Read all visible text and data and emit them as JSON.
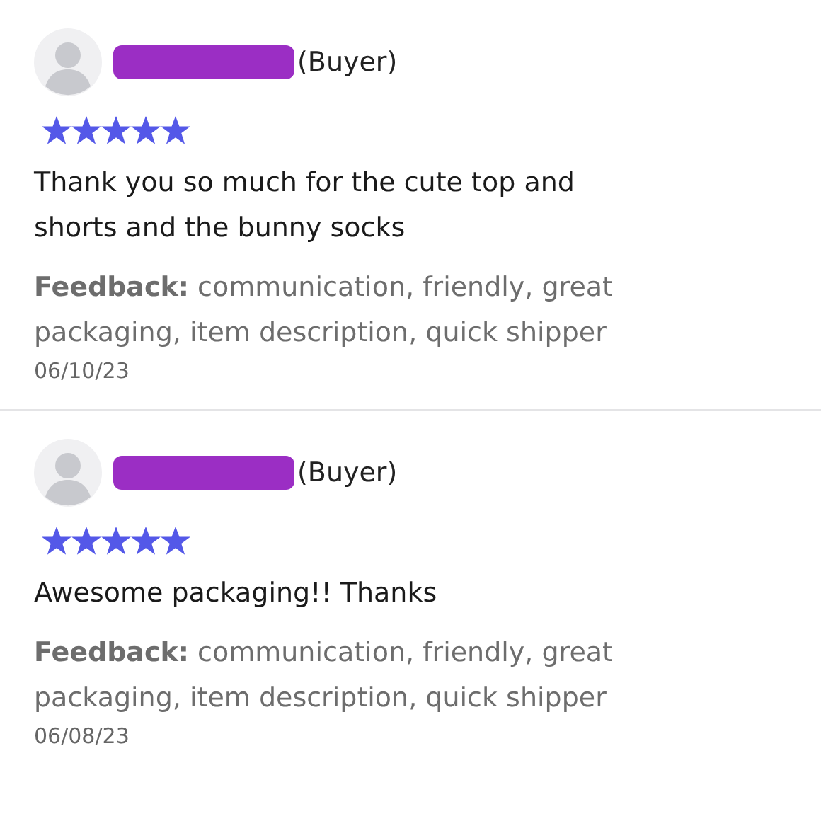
{
  "reviews": [
    {
      "role": "(Buyer)",
      "stars": 5,
      "comment": "Thank you so much for the cute top and shorts and the bunny socks",
      "feedback": "**Feedback:** communication, friendly, great packaging, item description, quick shipper",
      "date": "06/10/23"
    },
    {
      "role": "(Buyer)",
      "stars": 5,
      "comment": "Awesome packaging!! Thanks",
      "feedback": "**Feedback:** communication, friendly, great packaging, item description, quick shipper",
      "date": "06/08/23"
    }
  ]
}
